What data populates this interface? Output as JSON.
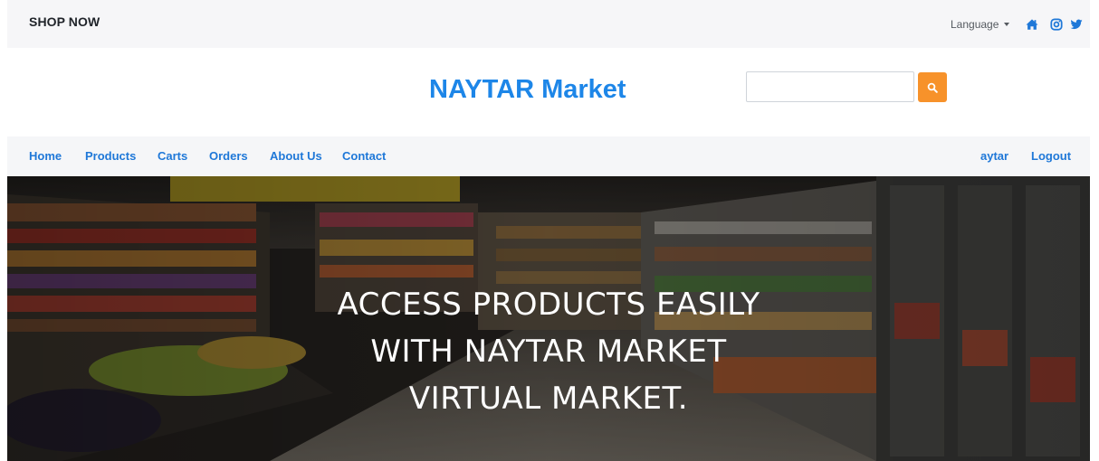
{
  "topbar": {
    "shop_now": "SHOP NOW",
    "language_label": "Language",
    "icons": [
      "home-icon",
      "instagram-icon",
      "twitter-icon"
    ]
  },
  "brand": {
    "name": "NAYTAR Market",
    "search_placeholder": "",
    "search_icon": "search-icon"
  },
  "nav": {
    "items": [
      {
        "label": "Home"
      },
      {
        "label": "Products"
      },
      {
        "label": "Carts"
      },
      {
        "label": "Orders"
      },
      {
        "label": "About Us"
      },
      {
        "label": "Contact"
      }
    ],
    "user": "aytar",
    "logout": "Logout"
  },
  "hero": {
    "lines": [
      "ACCESS PRODUCTS EASILY",
      "WITH NAYTAR MARKET",
      "VIRTUAL MARKET."
    ]
  },
  "colors": {
    "brand": "#1d86e8",
    "nav_link": "#1f78d8",
    "search_button": "#f7922a",
    "bar_bg": "#f5f6f8"
  }
}
